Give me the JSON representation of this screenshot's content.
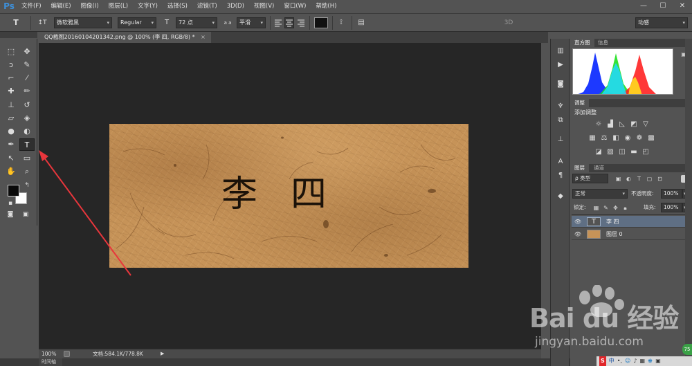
{
  "app": {
    "logo": "Ps",
    "menu": [
      "文件(F)",
      "编辑(E)",
      "图像(I)",
      "图层(L)",
      "文字(Y)",
      "选择(S)",
      "滤镜(T)",
      "3D(D)",
      "视图(V)",
      "窗口(W)",
      "帮助(H)"
    ],
    "window_controls": [
      "—",
      "☐",
      "✕"
    ]
  },
  "options": {
    "tool_icon": "T",
    "orient_icon": "↕T",
    "font_family": "微软雅黑",
    "font_style": "Regular",
    "size_icon": "T",
    "font_size": "72 点",
    "aa_icon": "a a",
    "antialias": "平滑",
    "align_icons": [
      "align-left-icon",
      "align-center-icon",
      "align-right-icon"
    ],
    "text_color": "#111111",
    "mode_3d": "3D",
    "workspace": "动感"
  },
  "tools": {
    "active": "text-tool",
    "list": [
      {
        "name": "marquee-tool",
        "glyph": "⬚"
      },
      {
        "name": "move-tool",
        "glyph": "✥"
      },
      {
        "name": "lasso-tool",
        "glyph": "ↄ"
      },
      {
        "name": "quick-select-tool",
        "glyph": "✎"
      },
      {
        "name": "crop-tool",
        "glyph": "⌐"
      },
      {
        "name": "eyedropper-tool",
        "glyph": "⁄"
      },
      {
        "name": "healing-brush-tool",
        "glyph": "✚"
      },
      {
        "name": "brush-tool",
        "glyph": "✏"
      },
      {
        "name": "clone-stamp-tool",
        "glyph": "⊥"
      },
      {
        "name": "history-brush-tool",
        "glyph": "↺"
      },
      {
        "name": "eraser-tool",
        "glyph": "▱"
      },
      {
        "name": "paint-bucket-tool",
        "glyph": "◈"
      },
      {
        "name": "blur-tool",
        "glyph": "●"
      },
      {
        "name": "dodge-tool",
        "glyph": "◐"
      },
      {
        "name": "pen-tool",
        "glyph": "✒"
      },
      {
        "name": "text-tool",
        "glyph": "T"
      },
      {
        "name": "path-select-tool",
        "glyph": "↖"
      },
      {
        "name": "rectangle-tool",
        "glyph": "▭"
      },
      {
        "name": "hand-tool",
        "glyph": "✋"
      },
      {
        "name": "zoom-tool",
        "glyph": "⌕"
      }
    ]
  },
  "document": {
    "tab_title": "QQ截图20160104201342.png @ 100% (李   四, RGB/8) *",
    "close": "×",
    "canvas_text": "李四",
    "zoom": "100%",
    "doc_info": "文档:584.1K/778.8K",
    "timeline": "时间轴"
  },
  "panels": {
    "histogram_tabs": [
      "直方图",
      "信息"
    ],
    "adjust_tab": "调整",
    "adjust_label": "添加调整",
    "layers_tabs": [
      "图层",
      "通道"
    ],
    "filter_kind": "ρ 类型",
    "blend_mode": "正常",
    "opacity_label": "不透明度:",
    "opacity_value": "100%",
    "lock_label": "锁定:",
    "fill_label": "填充:",
    "fill_value": "100%",
    "layers": [
      {
        "name": "李   四",
        "kind": "text",
        "selected": true
      },
      {
        "name": "图层 0",
        "kind": "image",
        "selected": false
      }
    ]
  },
  "watermark": {
    "logo": "Bai du 经验",
    "url": "jingyan.baidu.com"
  },
  "tray": {
    "badge": "75"
  }
}
